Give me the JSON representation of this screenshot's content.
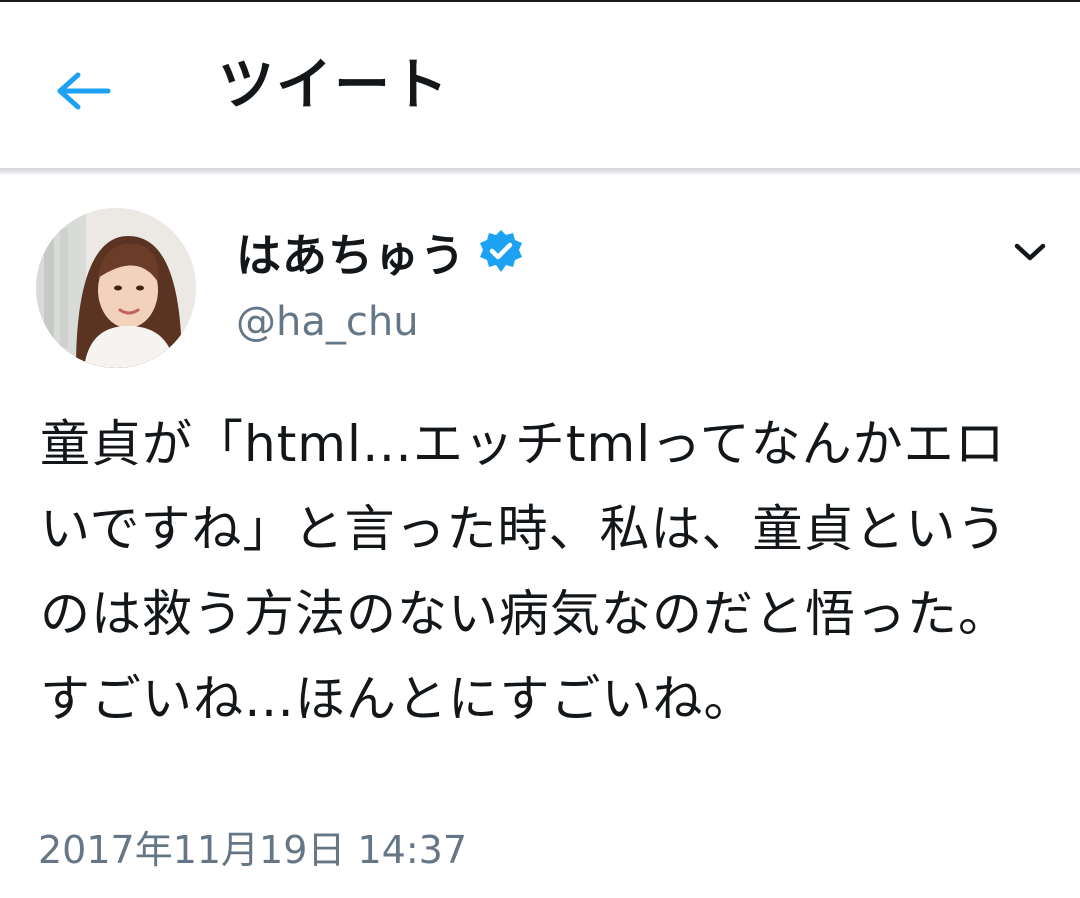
{
  "header": {
    "title": "ツイート",
    "back_icon": "arrow-left-icon",
    "accent_color": "#1da1f2"
  },
  "tweet": {
    "display_name": "はあちゅう",
    "verified_icon": "verified-badge-icon",
    "verified_color": "#1da1f2",
    "handle": "@ha_chu",
    "menu_icon": "chevron-down-icon",
    "text": "童貞が「html…エッチtmlってなんかエロいですね」と言った時、私は、童貞というのは救う方法のない病気なのだと悟った。すごいね…ほんとにすごいね。",
    "timestamp": "2017年11月19日 14:37"
  }
}
